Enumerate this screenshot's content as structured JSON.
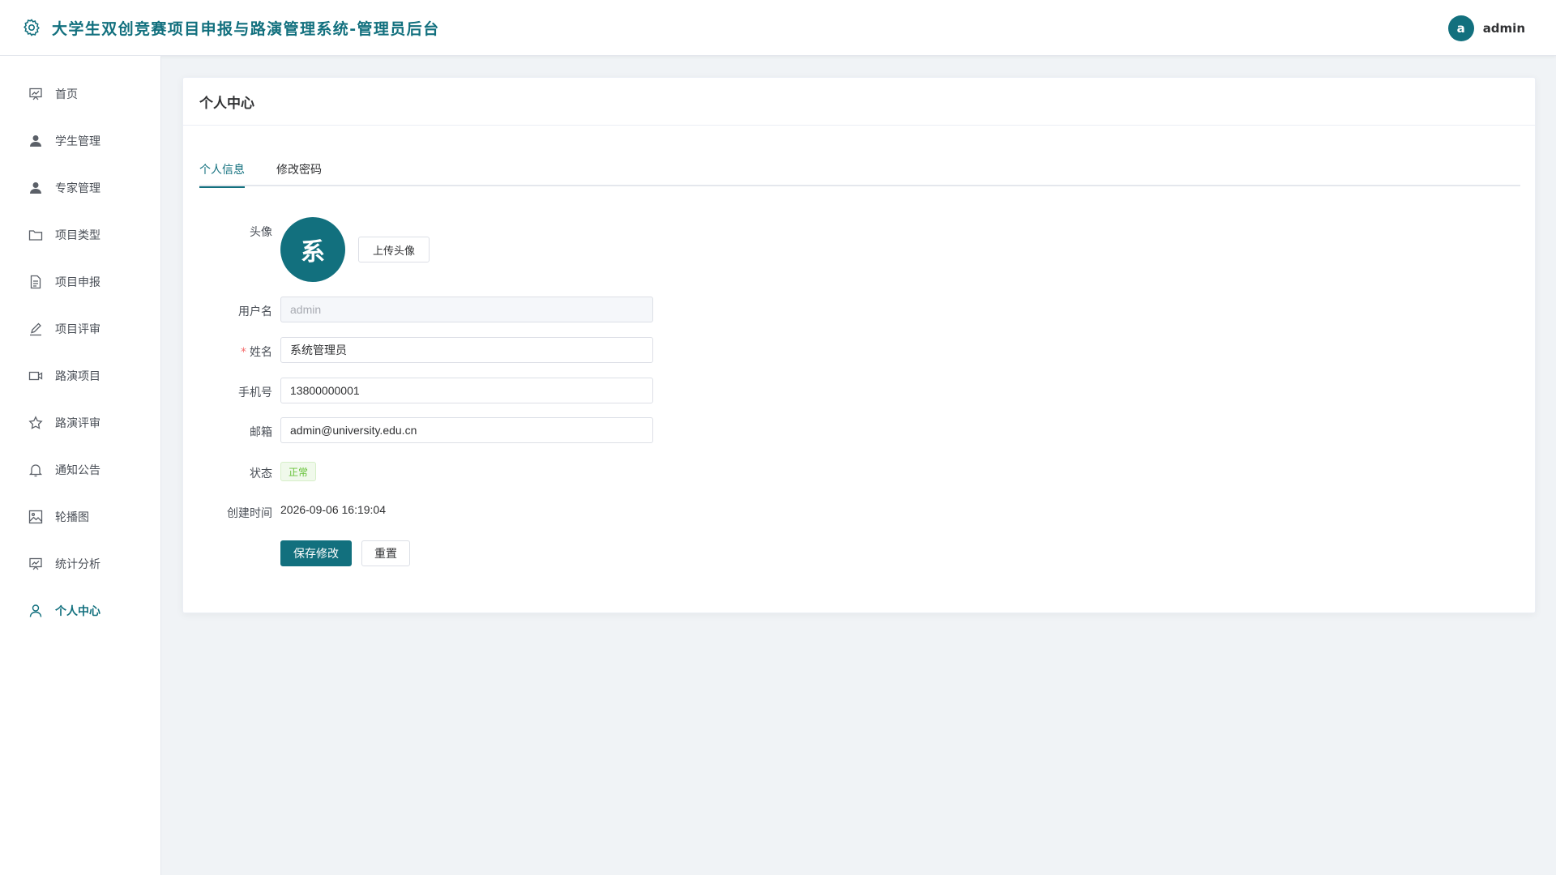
{
  "header": {
    "title": "大学生双创竞赛项目申报与路演管理系统-管理员后台",
    "avatar_letter": "a",
    "username": "admin",
    "logo_icon": "gear-icon"
  },
  "sidebar": {
    "items": [
      {
        "label": "首页",
        "icon": "chart-board-icon"
      },
      {
        "label": "学生管理",
        "icon": "user-filled-icon"
      },
      {
        "label": "专家管理",
        "icon": "user-filled-icon"
      },
      {
        "label": "项目类型",
        "icon": "folder-icon"
      },
      {
        "label": "项目申报",
        "icon": "document-icon"
      },
      {
        "label": "项目评审",
        "icon": "edit-pen-icon"
      },
      {
        "label": "路演项目",
        "icon": "video-camera-icon"
      },
      {
        "label": "路演评审",
        "icon": "star-icon"
      },
      {
        "label": "通知公告",
        "icon": "bell-icon"
      },
      {
        "label": "轮播图",
        "icon": "picture-icon"
      },
      {
        "label": "统计分析",
        "icon": "chart-board-icon"
      },
      {
        "label": "个人中心",
        "icon": "user-outline-icon",
        "active": true
      }
    ]
  },
  "card": {
    "title": "个人中心",
    "tabs": [
      {
        "label": "个人信息",
        "active": true
      },
      {
        "label": "修改密码",
        "active": false
      }
    ],
    "form": {
      "avatar_label": "头像",
      "avatar_text": "系",
      "upload_button": "上传头像",
      "username_label": "用户名",
      "username_value": "admin",
      "name_label": "姓名",
      "name_required_mark": "*",
      "name_value": "系统管理员",
      "phone_label": "手机号",
      "phone_value": "13800000001",
      "email_label": "邮箱",
      "email_value": "admin@university.edu.cn",
      "status_label": "状态",
      "status_value": "正常",
      "created_label": "创建时间",
      "created_value": "2026-09-06 16:19:04",
      "save_button": "保存修改",
      "reset_button": "重置"
    }
  },
  "colors": {
    "primary": "#12707e",
    "success": "#67c23a",
    "required": "#f56c6c",
    "background": "#f0f3f6"
  }
}
